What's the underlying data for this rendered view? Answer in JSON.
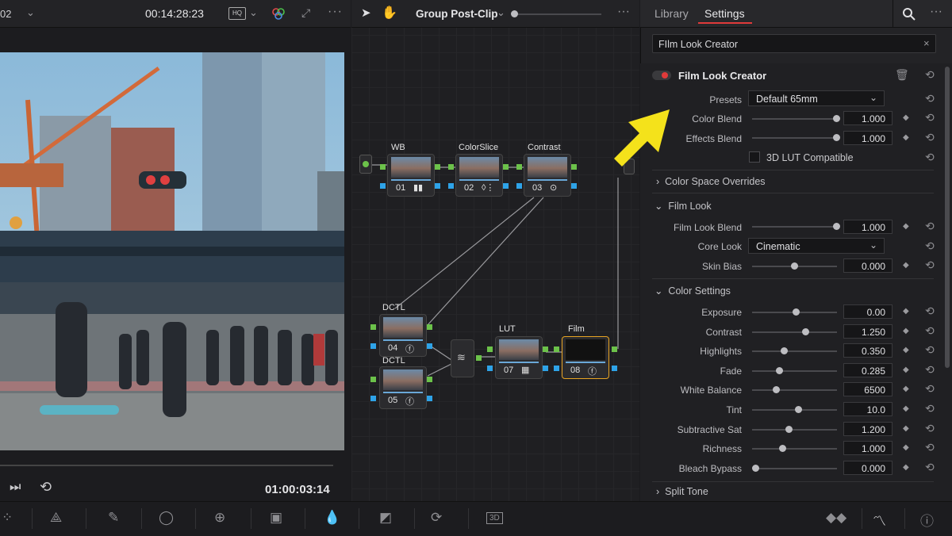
{
  "viewer": {
    "clip_id": "02",
    "timecode": "00:14:28:23",
    "playback_timecode": "01:00:03:14"
  },
  "node_editor": {
    "mode": "Group Post-Clip",
    "nodes": [
      {
        "label": "WB",
        "num": "01"
      },
      {
        "label": "ColorSlice",
        "num": "02"
      },
      {
        "label": "Contrast",
        "num": "03"
      },
      {
        "label": "DCTL",
        "num": "04"
      },
      {
        "label": "DCTL",
        "num": "05"
      },
      {
        "label": "LUT",
        "num": "07"
      },
      {
        "label": "Film",
        "num": "08"
      }
    ]
  },
  "panel": {
    "tabs": {
      "library": "Library",
      "settings": "Settings"
    },
    "search_value": "FIlm Look Creator",
    "effect_title": "Film Look Creator",
    "presets_label": "Presets",
    "presets_value": "Default 65mm",
    "color_blend": {
      "label": "Color Blend",
      "value": "1.000",
      "level": 1.0
    },
    "effects_blend": {
      "label": "Effects Blend",
      "value": "1.000",
      "level": 1.0
    },
    "lut_compatible": "3D LUT Compatible",
    "sections": {
      "color_space_overrides": "Color Space Overrides",
      "film_look": "Film Look",
      "color_settings": "Color Settings",
      "split_tone": "Split Tone"
    },
    "film_look_blend": {
      "label": "Film Look Blend",
      "value": "1.000",
      "level": 1.0
    },
    "core_look": {
      "label": "Core Look",
      "value": "Cinematic"
    },
    "skin_bias": {
      "label": "Skin Bias",
      "value": "0.000",
      "level": 0.5
    },
    "color_settings": [
      {
        "label": "Exposure",
        "value": "0.00",
        "level": 0.5
      },
      {
        "label": "Contrast",
        "value": "1.250",
        "level": 0.62
      },
      {
        "label": "Highlights",
        "value": "0.350",
        "level": 0.35
      },
      {
        "label": "Fade",
        "value": "0.285",
        "level": 0.29
      },
      {
        "label": "White Balance",
        "value": "6500",
        "level": 0.25
      },
      {
        "label": "Tint",
        "value": "10.0",
        "level": 0.53
      },
      {
        "label": "Subtractive Sat",
        "value": "1.200",
        "level": 0.41
      },
      {
        "label": "Richness",
        "value": "1.000",
        "level": 0.33
      },
      {
        "label": "Bleach Bypass",
        "value": "0.000",
        "level": 0.0
      }
    ]
  },
  "colors": {
    "accent": "#e03a3a",
    "arrow": "#f4e21b",
    "node_input": "#6cc24a",
    "node_output": "#2ea3e8"
  }
}
